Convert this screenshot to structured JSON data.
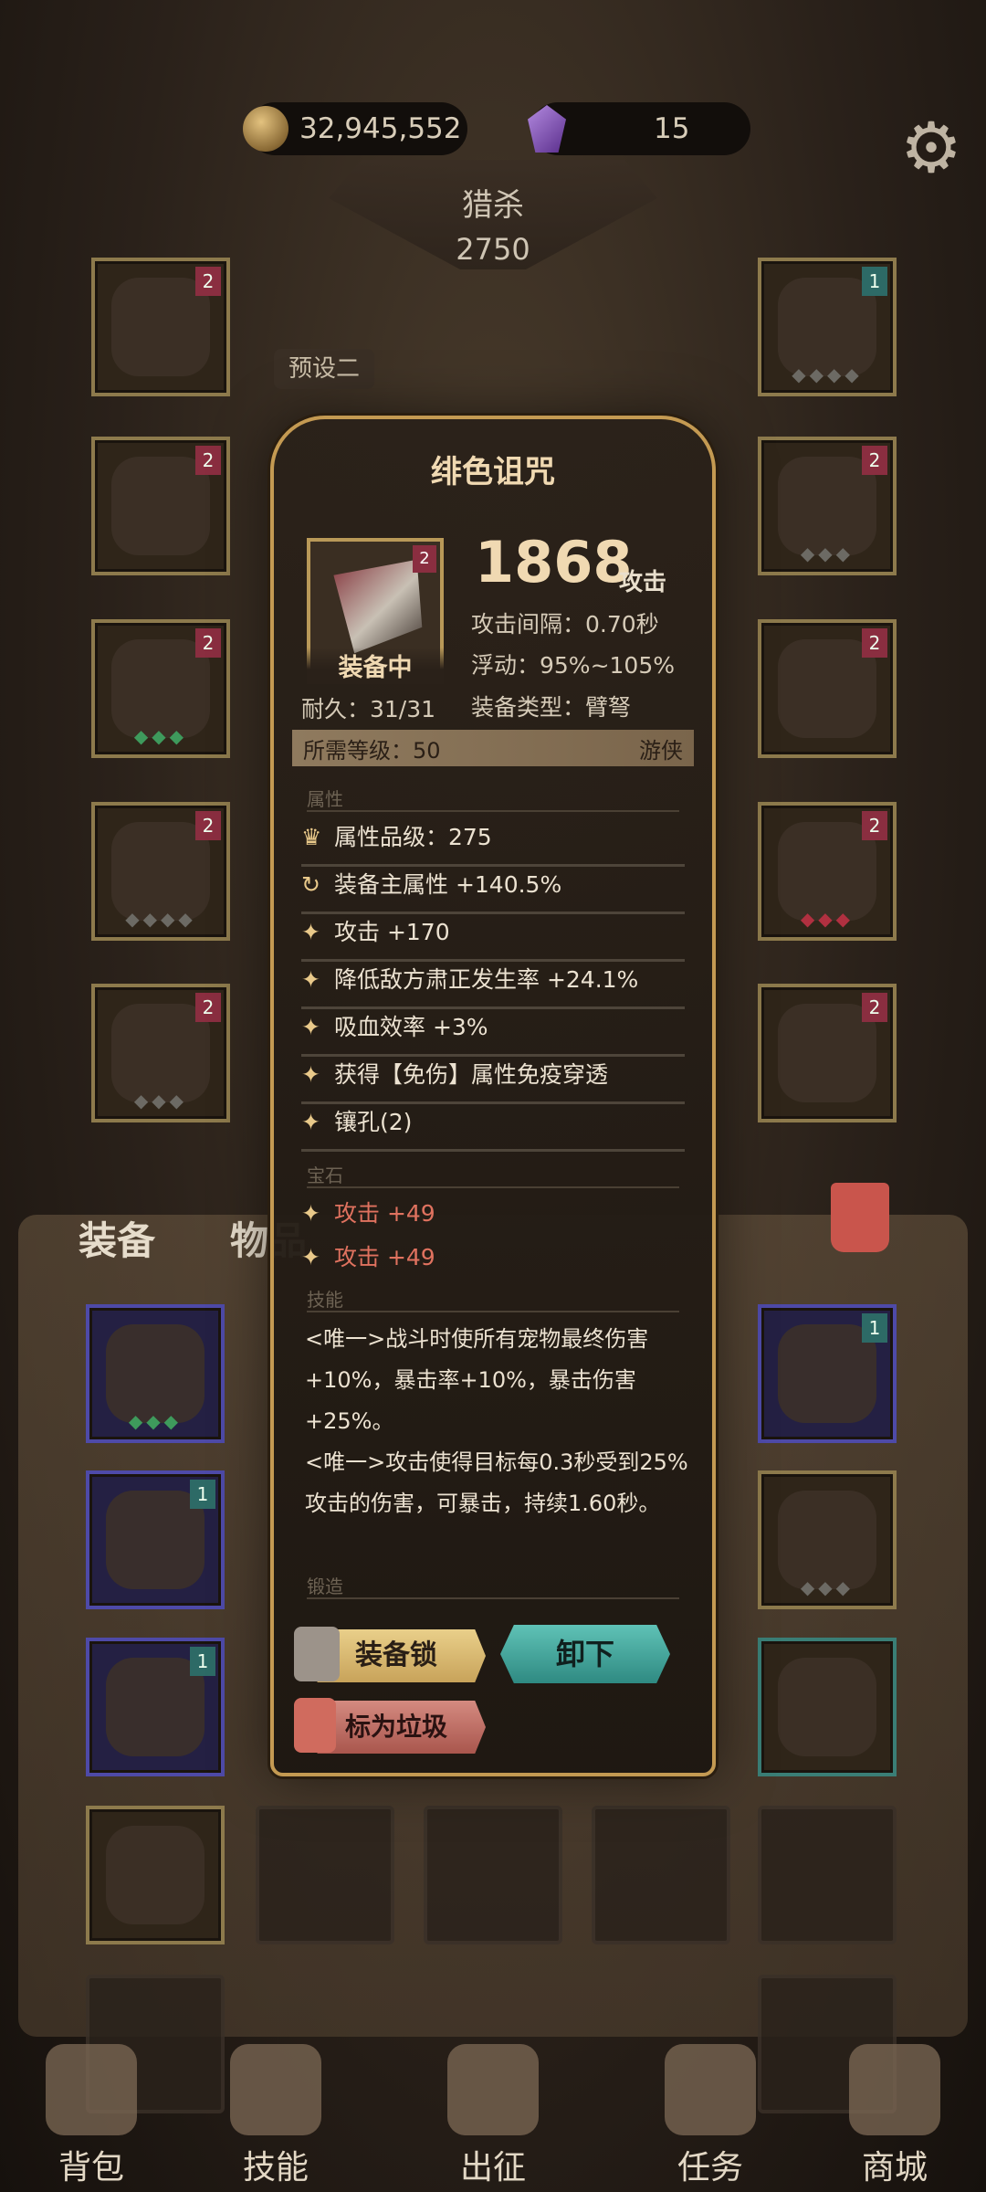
{
  "currency": {
    "gold": "32,945,552",
    "gems": "15"
  },
  "hunt": {
    "title": "猎杀",
    "value": "2750"
  },
  "preset_label": "预设二",
  "tabs": {
    "equipment": "装备",
    "items": "物品"
  },
  "popup": {
    "title": "绯色诅咒",
    "item_level_badge": "2",
    "equipped_label": "装备中",
    "attack_value": "1868",
    "attack_unit": "攻击",
    "attack_interval": "攻击间隔：0.70秒",
    "fluctuation": "浮动：95%~105%",
    "durability": "耐久：31/31",
    "equip_type": "装备类型：臂弩",
    "required_level": "所需等级：50",
    "class": "游侠",
    "sections": {
      "attributes": "属性",
      "gems": "宝石",
      "skills": "技能",
      "forge": "锻造"
    },
    "attributes": [
      "属性品级：275",
      "装备主属性 +140.5%",
      "攻击 +170",
      "降低敌方肃正发生率 +24.1%",
      "吸血效率 +3%",
      "获得【免伤】属性免疫穿透",
      "镶孔(2)"
    ],
    "gem_bonuses": [
      "攻击 +49",
      "攻击 +49"
    ],
    "skills": [
      "<唯一>战斗时使所有宠物最终伤害+10%，暴击率+10%，暴击伤害+25%。",
      "<唯一>攻击使得目标每0.3秒受到25%攻击的伤害，可暴击，持续1.60秒。"
    ],
    "buttons": {
      "lock": "装备锁",
      "unequip": "卸下",
      "junk": "标为垃圾"
    }
  },
  "nav": {
    "bag": "背包",
    "skills": "技能",
    "battle": "出征",
    "tasks": "任务",
    "shop": "商城"
  },
  "colors": {
    "gold_accent": "#c49a52",
    "unequip": "#3fa89d",
    "gem_text": "#e0725f"
  }
}
